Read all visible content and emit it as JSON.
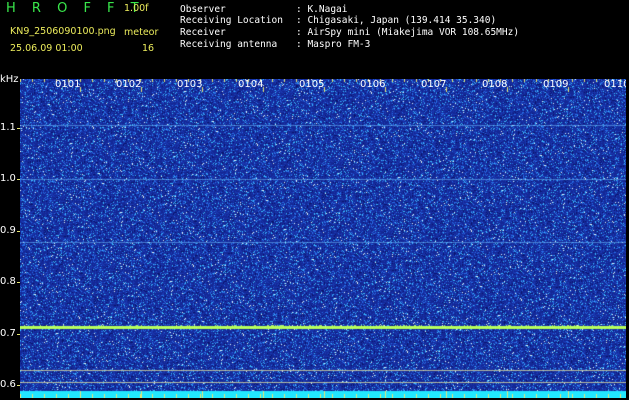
{
  "app": {
    "logo": "H R O F F T",
    "version": "1.00f",
    "filename": "KN9_2506090100.png",
    "datetime": "25.06.09 01:00",
    "mode_label": "meteor",
    "mode_value": "16"
  },
  "info": {
    "observer_label": "Observer",
    "observer_value": ": K.Nagai",
    "location_label": "Receiving Location",
    "location_value": ": Chigasaki, Japan (139.414 35.340)",
    "receiver_label": "Receiver",
    "receiver_value": ": AirSpy mini (Miakejima VOR 108.65MHz)",
    "antenna_label": "Receiving antenna",
    "antenna_value": ": Maspro FM-3"
  },
  "waterfall": {
    "unit_label": "kHz",
    "y_ticks": [
      "1.1",
      "1.0",
      "0.9",
      "0.8",
      "0.7",
      "0.6"
    ],
    "y_tick_values": [
      1.1,
      1.0,
      0.9,
      0.8,
      0.7,
      0.6
    ],
    "y_range": [
      0.575,
      1.195
    ],
    "time_labels": [
      "0101",
      "0102",
      "0103",
      "0104",
      "0105",
      "0106",
      "0107",
      "0108",
      "0109",
      "0110"
    ],
    "signal_lines_khz": [
      1.105,
      1.0,
      0.878,
      0.715
    ],
    "colors": {
      "background": "#1b2f9c",
      "noise_bright": "#37b3ff",
      "signal": "#b6ff5a",
      "bottom_band": "#22e8ff"
    }
  }
}
